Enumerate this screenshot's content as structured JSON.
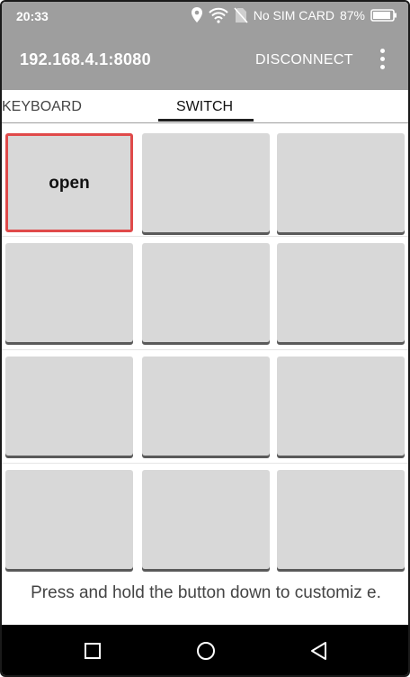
{
  "status_bar": {
    "time": "20:33",
    "sim_text": "No SIM CARD",
    "battery": "87%",
    "icons": [
      "location-icon",
      "wifi-icon",
      "no-sim-icon",
      "battery-icon"
    ]
  },
  "app_bar": {
    "title": "192.168.4.1:8080",
    "disconnect_label": "DISCONNECT",
    "menu_icon": "more-vert-icon"
  },
  "tabs": [
    {
      "label": "KEYBOARD",
      "selected": false
    },
    {
      "label": "SWITCH",
      "selected": true
    }
  ],
  "grid": {
    "buttons": [
      {
        "label": "open",
        "selected": true
      },
      {
        "label": ""
      },
      {
        "label": ""
      },
      {
        "label": ""
      },
      {
        "label": ""
      },
      {
        "label": ""
      },
      {
        "label": ""
      },
      {
        "label": ""
      },
      {
        "label": ""
      },
      {
        "label": ""
      },
      {
        "label": ""
      },
      {
        "label": ""
      }
    ]
  },
  "hint": "Press and hold the button down to customiz e.",
  "nav_bar": {
    "icons": [
      "recent-apps-icon",
      "home-icon",
      "back-icon"
    ]
  },
  "colors": {
    "bars": "#9e9e9e",
    "selected_border": "#e04a4a",
    "cell": "#d8d8d8"
  }
}
